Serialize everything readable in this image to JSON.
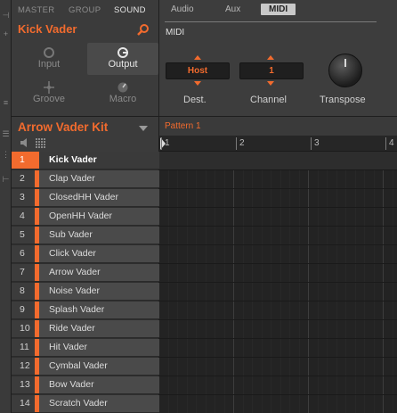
{
  "colors": {
    "accent": "#f26b2e",
    "panel": "#3b3b3b",
    "row": "#4a4a4a"
  },
  "top_tabs": [
    "MASTER",
    "GROUP",
    "SOUND"
  ],
  "active_top_tab": "SOUND",
  "sound_name": "Kick Vader",
  "modules": [
    {
      "label": "Input",
      "icon": "input-icon",
      "active": false
    },
    {
      "label": "Output",
      "icon": "output-icon",
      "active": true
    },
    {
      "label": "Groove",
      "icon": "groove-icon",
      "active": false
    },
    {
      "label": "Macro",
      "icon": "macro-icon",
      "active": false
    }
  ],
  "output_tabs": [
    "Audio",
    "Aux",
    "MIDI"
  ],
  "active_output_tab": "MIDI",
  "section_label": "MIDI",
  "controls": {
    "dest": {
      "value": "Host",
      "label": "Dest."
    },
    "channel": {
      "value": "1",
      "label": "Channel"
    },
    "transpose": {
      "label": "Transpose"
    }
  },
  "kit": {
    "name": "Arrow Vader Kit"
  },
  "sounds": [
    {
      "num": "1",
      "name": "Kick Vader",
      "selected": true
    },
    {
      "num": "2",
      "name": "Clap Vader"
    },
    {
      "num": "3",
      "name": "ClosedHH Vader"
    },
    {
      "num": "4",
      "name": "OpenHH Vader"
    },
    {
      "num": "5",
      "name": "Sub Vader"
    },
    {
      "num": "6",
      "name": "Click Vader"
    },
    {
      "num": "7",
      "name": "Arrow Vader"
    },
    {
      "num": "8",
      "name": "Noise Vader"
    },
    {
      "num": "9",
      "name": "Splash Vader"
    },
    {
      "num": "10",
      "name": "Ride Vader"
    },
    {
      "num": "11",
      "name": "Hit Vader"
    },
    {
      "num": "12",
      "name": "Cymbal Vader"
    },
    {
      "num": "13",
      "name": "Bow Vader"
    },
    {
      "num": "14",
      "name": "Scratch Vader"
    }
  ],
  "pattern": {
    "name": "Pattern 1",
    "bars": [
      "1",
      "2",
      "3",
      "4"
    ]
  }
}
